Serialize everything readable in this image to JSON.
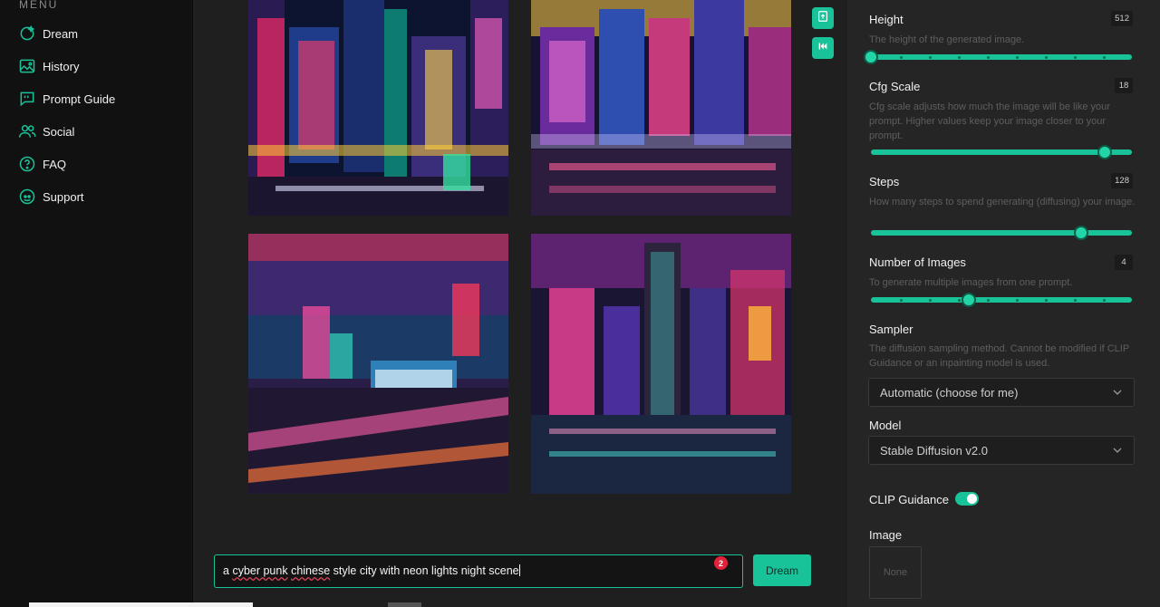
{
  "sidebar": {
    "menu_label": "MENU",
    "items": [
      {
        "label": "Dream",
        "icon": "sparkle-user-icon"
      },
      {
        "label": "History",
        "icon": "image-icon"
      },
      {
        "label": "Prompt Guide",
        "icon": "quote-bubble-icon"
      },
      {
        "label": "Social",
        "icon": "users-icon"
      },
      {
        "label": "FAQ",
        "icon": "question-icon"
      },
      {
        "label": "Support",
        "icon": "discord-icon"
      }
    ]
  },
  "main": {
    "prompt": {
      "word_a": "a",
      "word_cyber_punk": "cyber punk",
      "word_chinese": "chinese",
      "rest": "style city with neon lights night scene"
    },
    "badge_count": "2",
    "dream_button": "Dream",
    "side_buttons": [
      "upload-icon",
      "rewind-icon"
    ]
  },
  "settings": {
    "height": {
      "title": "Height",
      "value": "512",
      "desc": "The height of the generated image.",
      "fraction": 0.0
    },
    "cfg_scale": {
      "title": "Cfg Scale",
      "value": "18",
      "desc": "Cfg scale adjusts how much the image will be like your prompt. Higher values keep your image closer to your prompt.",
      "fraction": 0.897
    },
    "steps": {
      "title": "Steps",
      "value": "128",
      "desc": "How many steps to spend generating (diffusing) your image.",
      "fraction": 0.805
    },
    "num_images": {
      "title": "Number of Images",
      "value": "4",
      "desc": "To generate multiple images from one prompt.",
      "fraction": 0.375
    },
    "sampler": {
      "title": "Sampler",
      "desc": "The diffusion sampling method. Cannot be modified if CLIP Guidance or an inpainting model is used.",
      "selected": "Automatic (choose for me)"
    },
    "model": {
      "title": "Model",
      "selected": "Stable Diffusion v2.0"
    },
    "clip_guidance": {
      "title": "CLIP Guidance",
      "enabled": true
    },
    "image": {
      "title": "Image",
      "placeholder": "None"
    }
  },
  "colors": {
    "accent": "#19c39a",
    "badge": "#e2213a"
  }
}
